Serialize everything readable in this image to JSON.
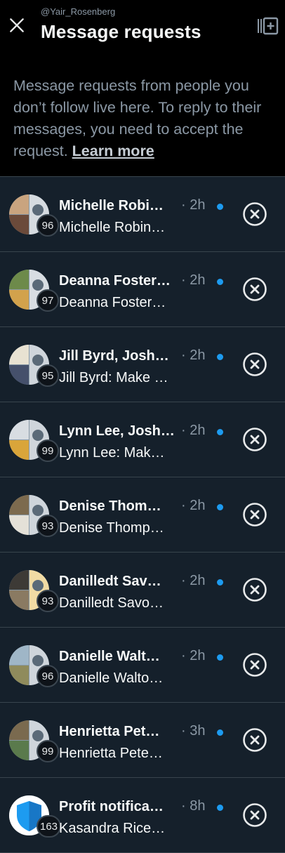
{
  "header": {
    "handle": "@Yair_Rosenberg",
    "title": "Message requests"
  },
  "info": {
    "text": "Message requests from people you don’t follow live here. To reply to their messages, you need to accept the request.",
    "learn_more": "Learn more"
  },
  "colors": {
    "background": "#15202b",
    "header_background": "#000000",
    "unread_dot": "#1d9bf0",
    "secondary_text": "#8b98a5",
    "divider": "#38444d"
  },
  "icons": {
    "close": "close-icon",
    "compose": "compose-icon",
    "dismiss": "dismiss-circle-x-icon",
    "unread": "unread-dot-icon"
  },
  "requests": [
    {
      "name": "Michelle Robi…",
      "time": "· 2h",
      "count": "96",
      "preview": "Michelle Robin…",
      "unread": true
    },
    {
      "name": "Deanna Foster…",
      "time": "· 2h",
      "count": "97",
      "preview": "Deanna Foster…",
      "unread": true
    },
    {
      "name": "Jill Byrd, Josh…",
      "time": "· 2h",
      "count": "95",
      "preview": "Jill Byrd: Make …",
      "unread": true
    },
    {
      "name": "Lynn Lee, Josh…",
      "time": "· 2h",
      "count": "99",
      "preview": "Lynn Lee: Mak…",
      "unread": true
    },
    {
      "name": "Denise Thom…",
      "time": "· 2h",
      "count": "93",
      "preview": "Denise Thomp…",
      "unread": true
    },
    {
      "name": "Danilledt Sav…",
      "time": "· 2h",
      "count": "93",
      "preview": "Danilledt Savo…",
      "unread": true
    },
    {
      "name": "Danielle Walt…",
      "time": "· 2h",
      "count": "96",
      "preview": "Danielle Walto…",
      "unread": true
    },
    {
      "name": "Henrietta Pet…",
      "time": "· 3h",
      "count": "99",
      "preview": "Henrietta Pete…",
      "unread": true
    },
    {
      "name": "Profit notifica…",
      "time": "· 8h",
      "count": "163",
      "preview": "Kasandra Rice…",
      "unread": true
    }
  ]
}
